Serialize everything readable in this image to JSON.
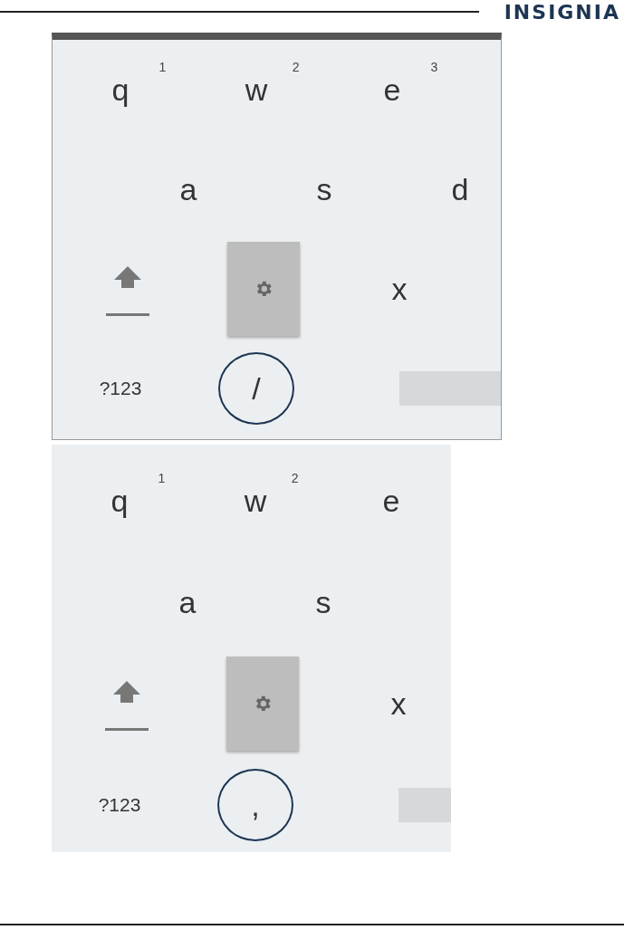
{
  "header": {
    "logo": "INSIGNIA"
  },
  "keyboards": [
    {
      "framed": true,
      "rows": [
        [
          {
            "kind": "letter",
            "label": "q",
            "hint": "1"
          },
          {
            "kind": "letter",
            "label": "w",
            "hint": "2"
          },
          {
            "kind": "letter",
            "label": "e",
            "hint": "3"
          }
        ],
        [
          {
            "kind": "letter",
            "label": "a"
          },
          {
            "kind": "letter",
            "label": "s"
          },
          {
            "kind": "letter",
            "label": "d"
          }
        ],
        [
          {
            "kind": "shift"
          },
          {
            "kind": "settings"
          },
          {
            "kind": "letter",
            "label": "x"
          }
        ],
        [
          {
            "kind": "symbols",
            "label": "?123"
          },
          {
            "kind": "circled",
            "label": "/"
          },
          {
            "kind": "space"
          }
        ]
      ]
    },
    {
      "framed": false,
      "rows": [
        [
          {
            "kind": "letter",
            "label": "q",
            "hint": "1"
          },
          {
            "kind": "letter",
            "label": "w",
            "hint": "2"
          },
          {
            "kind": "letter",
            "label": "e"
          }
        ],
        [
          {
            "kind": "letter",
            "label": "a"
          },
          {
            "kind": "letter",
            "label": "s"
          }
        ],
        [
          {
            "kind": "shift"
          },
          {
            "kind": "settings"
          },
          {
            "kind": "letter",
            "label": "x"
          }
        ],
        [
          {
            "kind": "symbols",
            "label": "?123"
          },
          {
            "kind": "circled",
            "label": ","
          },
          {
            "kind": "space"
          }
        ]
      ]
    }
  ]
}
